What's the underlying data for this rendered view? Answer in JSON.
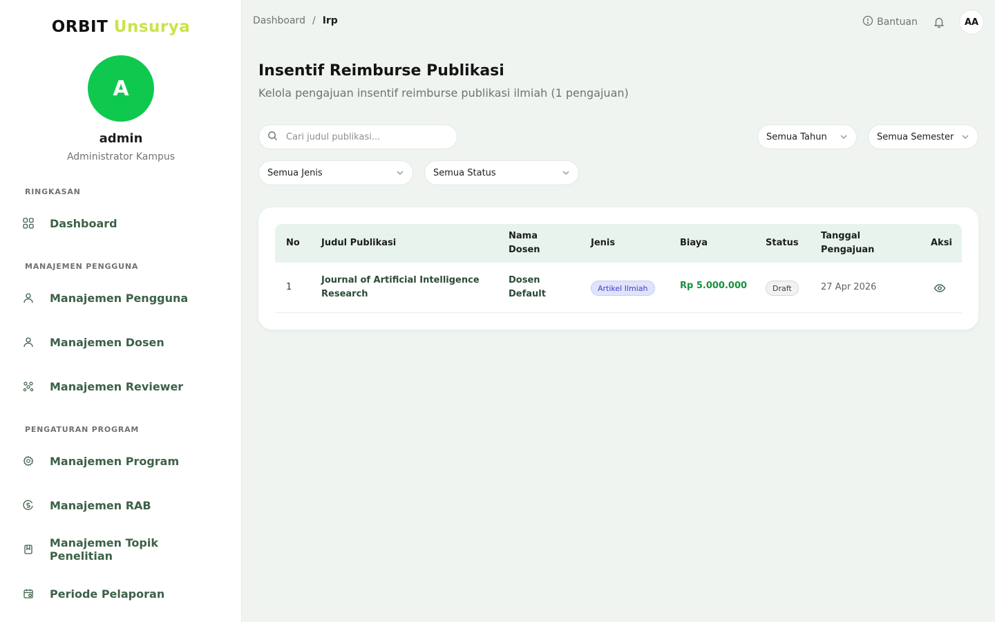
{
  "brand": {
    "part1": "ORBIT",
    "part2": "Unsurya"
  },
  "user": {
    "initial": "A",
    "name": "admin",
    "role": "Administrator Kampus"
  },
  "sidebar": {
    "sections": [
      {
        "label": "RINGKASAN"
      },
      {
        "label": "MANAJEMEN PENGGUNA"
      },
      {
        "label": "PENGATURAN PROGRAM"
      }
    ],
    "items": [
      {
        "label": "Dashboard",
        "icon": "grid-icon"
      },
      {
        "label": "Manajemen Pengguna",
        "icon": "user-icon"
      },
      {
        "label": "Manajemen Dosen",
        "icon": "user-icon"
      },
      {
        "label": "Manajemen Reviewer",
        "icon": "users-group-icon"
      },
      {
        "label": "Manajemen Program",
        "icon": "gear-icon"
      },
      {
        "label": "Manajemen RAB",
        "icon": "coin-icon"
      },
      {
        "label": "Manajemen Topik Penelitian",
        "icon": "bookmark-icon"
      },
      {
        "label": "Periode Pelaporan",
        "icon": "calendar-icon"
      }
    ]
  },
  "breadcrumb": {
    "root": "Dashboard",
    "separator": "/",
    "current": "Irp"
  },
  "topbar": {
    "help_label": "Bantuan",
    "avatar_initials": "AA"
  },
  "page": {
    "title": "Insentif Reimburse Publikasi",
    "subtitle": "Kelola pengajuan insentif reimburse publikasi ilmiah (1 pengajuan)"
  },
  "filters": {
    "search_placeholder": "Cari judul publikasi...",
    "tahun": "Semua Tahun",
    "semester": "Semua Semester",
    "jenis": "Semua Jenis",
    "status": "Semua Status"
  },
  "table": {
    "headers": {
      "no": "No",
      "judul": "Judul Publikasi",
      "dosen_1": "Nama",
      "dosen_2": "Dosen",
      "jenis": "Jenis",
      "biaya": "Biaya",
      "status": "Status",
      "tanggal_1": "Tanggal",
      "tanggal_2": "Pengajuan",
      "aksi": "Aksi"
    },
    "rows": [
      {
        "no": "1",
        "judul_1": "Journal of Artificial Intelligence",
        "judul_2": "Research",
        "dosen_1": "Dosen",
        "dosen_2": "Default",
        "jenis": "Artikel Ilmiah",
        "biaya": "Rp 5.000.000",
        "status": "Draft",
        "tanggal": "27 Apr 2026"
      }
    ]
  },
  "colors": {
    "brand_accent": "#c9e34a",
    "avatar_green": "#0fc94f",
    "nav_text": "#3c6147",
    "table_header_bg": "#e9f3ed",
    "money_green": "#15923c",
    "jenis_badge": "#3d3fc8"
  }
}
